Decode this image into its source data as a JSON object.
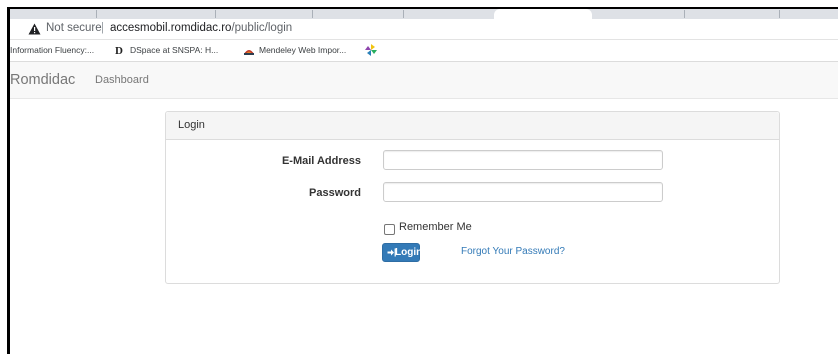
{
  "browser": {
    "security_label": "Not secure",
    "separator": "|",
    "url_host": "accesmobil.romdidac.ro",
    "url_path": "/public/login",
    "warning_icon": "warning-triangle-icon"
  },
  "bookmarks": [
    {
      "label": "Information Fluency:...",
      "icon": "none"
    },
    {
      "label": "DSpace at SNSPA: H...",
      "icon": "dspace-icon"
    },
    {
      "label": "Mendeley Web Impor...",
      "icon": "mendeley-icon"
    },
    {
      "label": "",
      "icon": "pinwheel-icon"
    }
  ],
  "navbar": {
    "brand": "Romdidac",
    "links": [
      {
        "label": "Dashboard"
      }
    ]
  },
  "login_panel": {
    "title": "Login",
    "email_label": "E-Mail Address",
    "email_value": "",
    "password_label": "Password",
    "password_value": "",
    "remember_label": "Remember Me",
    "remember_checked": false,
    "login_button": "Login",
    "login_icon": "sign-in-icon",
    "forgot_link": "Forgot Your Password?"
  },
  "colors": {
    "primary": "#337ab7",
    "navbar_bg": "#f8f8f8",
    "panel_heading_bg": "#f5f5f5",
    "link": "#337ab7"
  }
}
